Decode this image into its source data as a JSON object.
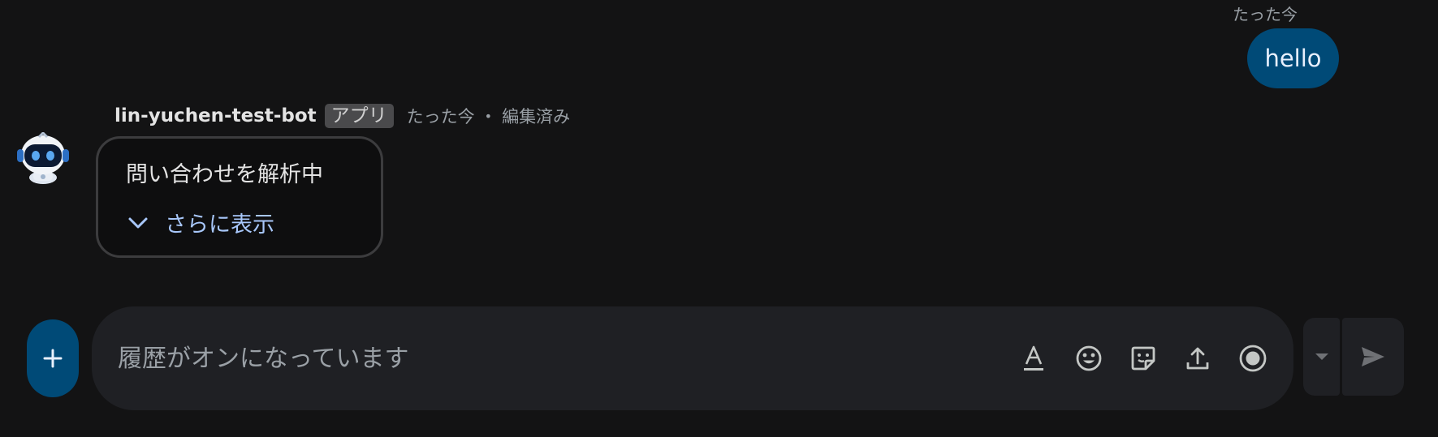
{
  "outgoing": {
    "time": "たった今",
    "text": "hello"
  },
  "bot_message": {
    "sender": "lin-yuchen-test-bot",
    "badge": "アプリ",
    "time": "たった今",
    "edited": "編集済み",
    "card_title": "問い合わせを解析中",
    "show_more_label": "さらに表示"
  },
  "composer": {
    "placeholder": "履歴がオンになっています",
    "tools": [
      "format-text-icon",
      "emoji-icon",
      "sticker-icon",
      "upload-icon",
      "record-icon"
    ]
  },
  "colors": {
    "background": "#131314",
    "accent_blue": "#004a77",
    "link_blue": "#a8c7fa",
    "composer_bg": "#1f2024"
  }
}
